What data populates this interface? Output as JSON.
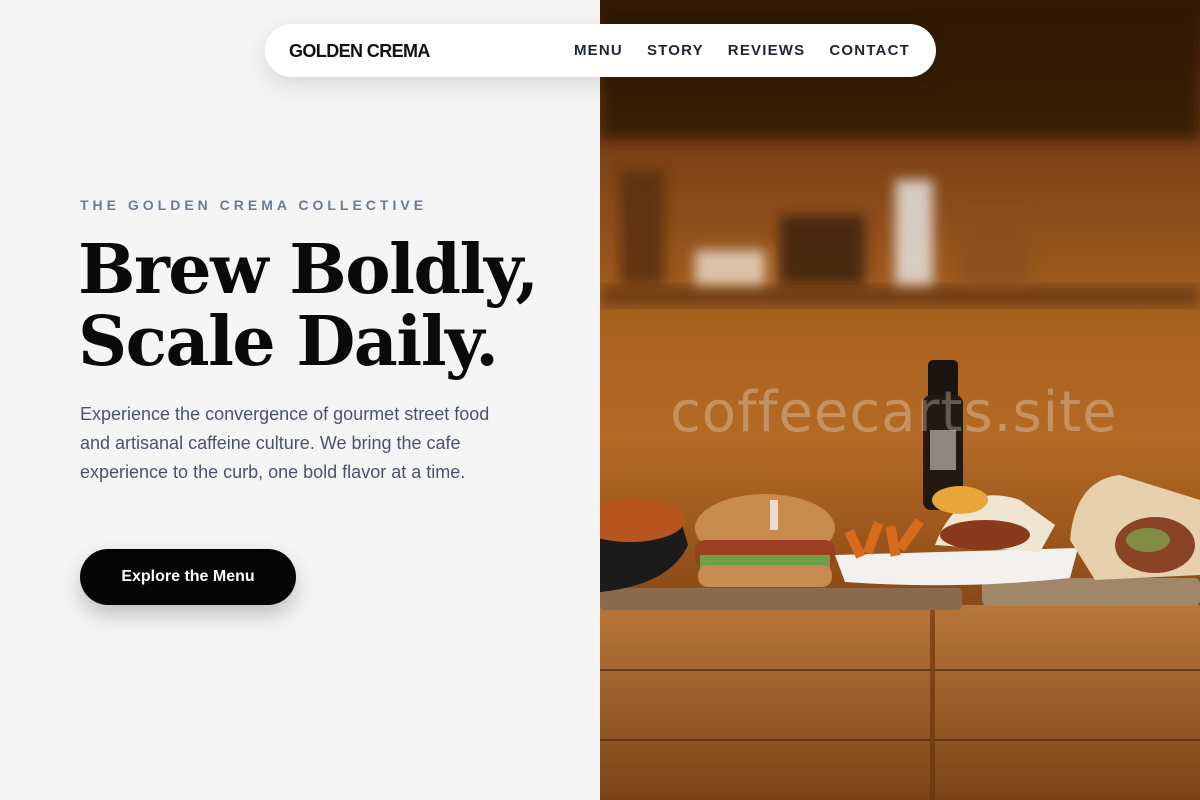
{
  "nav": {
    "brand": "GOLDEN CREMA",
    "links": [
      "MENU",
      "STORY",
      "REVIEWS",
      "CONTACT"
    ]
  },
  "hero": {
    "eyebrow": "THE GOLDEN CREMA COLLECTIVE",
    "headline_line1": "Brew Boldly,",
    "headline_line2": "Scale Daily.",
    "lede": "Experience the convergence of gourmet street food and artisanal caffeine culture. We bring the cafe experience to the curb, one bold flavor at a time.",
    "cta_label": "Explore the Menu"
  },
  "photo": {
    "watermark": "coffeecarts.site"
  },
  "colors": {
    "background": "#f5f5f5",
    "ink": "#0a0a0a",
    "eyebrow": "#6b7c93",
    "body_text": "#4a5468",
    "cta_bg": "#050505",
    "cta_text": "#ffffff"
  }
}
